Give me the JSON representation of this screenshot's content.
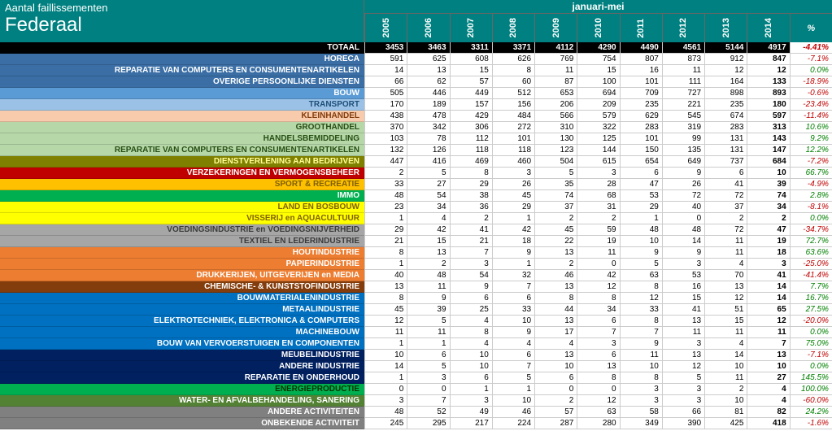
{
  "header": {
    "title_small": "Aantal faillissementen",
    "title_big": "Federaal",
    "period": "januari-mei",
    "years": [
      "2005",
      "2006",
      "2007",
      "2008",
      "2009",
      "2010",
      "2011",
      "2012",
      "2013",
      "2014"
    ],
    "pct_symbol": "%"
  },
  "rows": [
    {
      "label": "TOTAAL",
      "color": "#000000",
      "text": "#ffffff",
      "values": [
        "3453",
        "3463",
        "3311",
        "3371",
        "4112",
        "4290",
        "4490",
        "4561",
        "5144",
        "4917"
      ],
      "pct": "-4.41%",
      "total": true
    },
    {
      "label": "HORECA",
      "color": "#3a6ea5",
      "text": "#ffffff",
      "values": [
        "591",
        "625",
        "608",
        "626",
        "769",
        "754",
        "807",
        "873",
        "912",
        "847"
      ],
      "pct": "-7.1%"
    },
    {
      "label": "REPARATIE VAN COMPUTERS EN CONSUMENTENARTIKELEN",
      "color": "#3a6ea5",
      "text": "#ffffff",
      "values": [
        "14",
        "13",
        "15",
        "8",
        "11",
        "15",
        "16",
        "11",
        "12",
        "12"
      ],
      "pct": "0.0%"
    },
    {
      "label": "OVERIGE PERSOONLIJKE DIENSTEN",
      "color": "#3a6ea5",
      "text": "#ffffff",
      "values": [
        "66",
        "62",
        "57",
        "60",
        "87",
        "100",
        "101",
        "111",
        "164",
        "133"
      ],
      "pct": "-18.9%"
    },
    {
      "label": "BOUW",
      "color": "#5b9bd5",
      "text": "#ffffff",
      "values": [
        "505",
        "446",
        "449",
        "512",
        "653",
        "694",
        "709",
        "727",
        "898",
        "893"
      ],
      "pct": "-0.6%"
    },
    {
      "label": "TRANSPORT",
      "color": "#9bc2e6",
      "text": "#1f4e78",
      "values": [
        "170",
        "189",
        "157",
        "156",
        "206",
        "209",
        "235",
        "221",
        "235",
        "180"
      ],
      "pct": "-23.4%"
    },
    {
      "label": "KLEINHANDEL",
      "color": "#f8cbad",
      "text": "#843c0b",
      "values": [
        "438",
        "478",
        "429",
        "484",
        "566",
        "579",
        "629",
        "545",
        "674",
        "597"
      ],
      "pct": "-11.4%"
    },
    {
      "label": "GROOTHANDEL",
      "color": "#b6d7a8",
      "text": "#274e13",
      "values": [
        "370",
        "342",
        "306",
        "272",
        "310",
        "322",
        "283",
        "319",
        "283",
        "313"
      ],
      "pct": "10.6%"
    },
    {
      "label": "HANDELSBEMIDDELING",
      "color": "#b6d7a8",
      "text": "#274e13",
      "values": [
        "103",
        "78",
        "112",
        "101",
        "130",
        "125",
        "101",
        "99",
        "131",
        "143"
      ],
      "pct": "9.2%"
    },
    {
      "label": "REPARATIE VAN COMPUTERS EN CONSUMENTENARTIKELEN",
      "color": "#b6d7a8",
      "text": "#274e13",
      "values": [
        "132",
        "126",
        "118",
        "118",
        "123",
        "144",
        "150",
        "135",
        "131",
        "147"
      ],
      "pct": "12.2%"
    },
    {
      "label": "DIENSTVERLENING AAN BEDRIJVEN",
      "color": "#808000",
      "text": "#ffff99",
      "values": [
        "447",
        "416",
        "469",
        "460",
        "504",
        "615",
        "654",
        "649",
        "737",
        "684"
      ],
      "pct": "-7.2%"
    },
    {
      "label": "VERZEKERINGEN EN VERMOGENSBEHEER",
      "color": "#c00000",
      "text": "#ffffff",
      "values": [
        "2",
        "5",
        "8",
        "3",
        "5",
        "3",
        "6",
        "9",
        "6",
        "10"
      ],
      "pct": "66.7%"
    },
    {
      "label": "SPORT & RECREATIE",
      "color": "#ffc000",
      "text": "#7f6000",
      "values": [
        "33",
        "27",
        "29",
        "26",
        "35",
        "28",
        "47",
        "26",
        "41",
        "39"
      ],
      "pct": "-4.9%"
    },
    {
      "label": "IMMO",
      "color": "#00b050",
      "text": "#ffffff",
      "values": [
        "48",
        "54",
        "38",
        "45",
        "74",
        "68",
        "53",
        "72",
        "72",
        "74"
      ],
      "pct": "2.8%"
    },
    {
      "label": "LAND EN BOSBOUW",
      "color": "#ffff00",
      "text": "#7f6000",
      "values": [
        "23",
        "34",
        "36",
        "29",
        "37",
        "31",
        "29",
        "40",
        "37",
        "34"
      ],
      "pct": "-8.1%"
    },
    {
      "label": "VISSERIJ en AQUACULTUUR",
      "color": "#ffff00",
      "text": "#7f6000",
      "values": [
        "1",
        "4",
        "2",
        "1",
        "2",
        "2",
        "1",
        "0",
        "2",
        "2"
      ],
      "pct": "0.0%"
    },
    {
      "label": "VOEDINGSINDUSTRIE en VOEDINGSNIJVERHEID",
      "color": "#a6a6a6",
      "text": "#3b3b3b",
      "values": [
        "29",
        "42",
        "41",
        "42",
        "45",
        "59",
        "48",
        "48",
        "72",
        "47"
      ],
      "pct": "-34.7%"
    },
    {
      "label": "TEXTIEL EN LEDERINDUSTRIE",
      "color": "#a6a6a6",
      "text": "#3b3b3b",
      "values": [
        "21",
        "15",
        "21",
        "18",
        "22",
        "19",
        "10",
        "14",
        "11",
        "19"
      ],
      "pct": "72.7%"
    },
    {
      "label": "HOUTINDUSTRIE",
      "color": "#ed7d31",
      "text": "#ffffff",
      "values": [
        "8",
        "13",
        "7",
        "9",
        "13",
        "11",
        "9",
        "9",
        "11",
        "18"
      ],
      "pct": "63.6%"
    },
    {
      "label": "PAPIERINDUSTRIE",
      "color": "#ed7d31",
      "text": "#ffffff",
      "values": [
        "1",
        "2",
        "3",
        "1",
        "2",
        "0",
        "5",
        "3",
        "4",
        "3"
      ],
      "pct": "-25.0%"
    },
    {
      "label": "DRUKKERIJEN, UITGEVERIJEN en MEDIA",
      "color": "#ed7d31",
      "text": "#ffffff",
      "values": [
        "40",
        "48",
        "54",
        "32",
        "46",
        "42",
        "63",
        "53",
        "70",
        "41"
      ],
      "pct": "-41.4%"
    },
    {
      "label": "CHEMISCHE- & KUNSTSTOFINDUSTRIE",
      "color": "#833c0b",
      "text": "#ffffff",
      "values": [
        "13",
        "11",
        "9",
        "7",
        "13",
        "12",
        "8",
        "16",
        "13",
        "14"
      ],
      "pct": "7.7%"
    },
    {
      "label": "BOUWMATERIALENINDUSTRIE",
      "color": "#0070c0",
      "text": "#ffffff",
      "values": [
        "8",
        "9",
        "6",
        "6",
        "8",
        "8",
        "12",
        "15",
        "12",
        "14"
      ],
      "pct": "16.7%"
    },
    {
      "label": "METAALINDUSTRIE",
      "color": "#0070c0",
      "text": "#ffffff",
      "values": [
        "45",
        "39",
        "25",
        "33",
        "44",
        "34",
        "33",
        "41",
        "51",
        "65"
      ],
      "pct": "27.5%"
    },
    {
      "label": "ELEKTROTECHNIEK, ELEKTRONICA & COMPUTERS",
      "color": "#0070c0",
      "text": "#ffffff",
      "values": [
        "12",
        "5",
        "4",
        "10",
        "13",
        "6",
        "8",
        "13",
        "15",
        "12"
      ],
      "pct": "-20.0%"
    },
    {
      "label": "MACHINEBOUW",
      "color": "#0070c0",
      "text": "#ffffff",
      "values": [
        "11",
        "11",
        "8",
        "9",
        "17",
        "7",
        "7",
        "11",
        "11",
        "11"
      ],
      "pct": "0.0%"
    },
    {
      "label": "BOUW VAN VERVOERSTUIGEN EN COMPONENTEN",
      "color": "#0070c0",
      "text": "#ffffff",
      "values": [
        "1",
        "1",
        "4",
        "4",
        "4",
        "3",
        "9",
        "3",
        "4",
        "7"
      ],
      "pct": "75.0%"
    },
    {
      "label": "MEUBELINDUSTRIE",
      "color": "#002060",
      "text": "#ffffff",
      "values": [
        "10",
        "6",
        "10",
        "6",
        "13",
        "6",
        "11",
        "13",
        "14",
        "13"
      ],
      "pct": "-7.1%"
    },
    {
      "label": "ANDERE INDUSTRIE",
      "color": "#002060",
      "text": "#ffffff",
      "values": [
        "14",
        "5",
        "10",
        "7",
        "10",
        "13",
        "10",
        "12",
        "10",
        "10"
      ],
      "pct": "0.0%"
    },
    {
      "label": "REPARATIE EN ONDERHOUD",
      "color": "#002060",
      "text": "#ffffff",
      "values": [
        "1",
        "3",
        "6",
        "5",
        "6",
        "8",
        "8",
        "5",
        "11",
        "27"
      ],
      "pct": "145.5%"
    },
    {
      "label": "ENERGIEPRODUCTIE",
      "color": "#00b050",
      "text": "#003300",
      "values": [
        "0",
        "0",
        "1",
        "1",
        "0",
        "0",
        "3",
        "3",
        "2",
        "4"
      ],
      "pct": "100.0%"
    },
    {
      "label": "WATER- EN AFVALBEHANDELING, SANERING",
      "color": "#548235",
      "text": "#ffffff",
      "values": [
        "3",
        "7",
        "3",
        "10",
        "2",
        "12",
        "3",
        "3",
        "10",
        "4"
      ],
      "pct": "-60.0%"
    },
    {
      "label": "ANDERE ACTIVITEITEN",
      "color": "#808080",
      "text": "#ffffff",
      "values": [
        "48",
        "52",
        "49",
        "46",
        "57",
        "63",
        "58",
        "66",
        "81",
        "82"
      ],
      "pct": "24.2%"
    },
    {
      "label": "ONBEKENDE ACTIVITEIT",
      "color": "#808080",
      "text": "#ffffff",
      "values": [
        "245",
        "295",
        "217",
        "224",
        "287",
        "280",
        "349",
        "390",
        "425",
        "418"
      ],
      "pct": "-1.6%"
    }
  ]
}
